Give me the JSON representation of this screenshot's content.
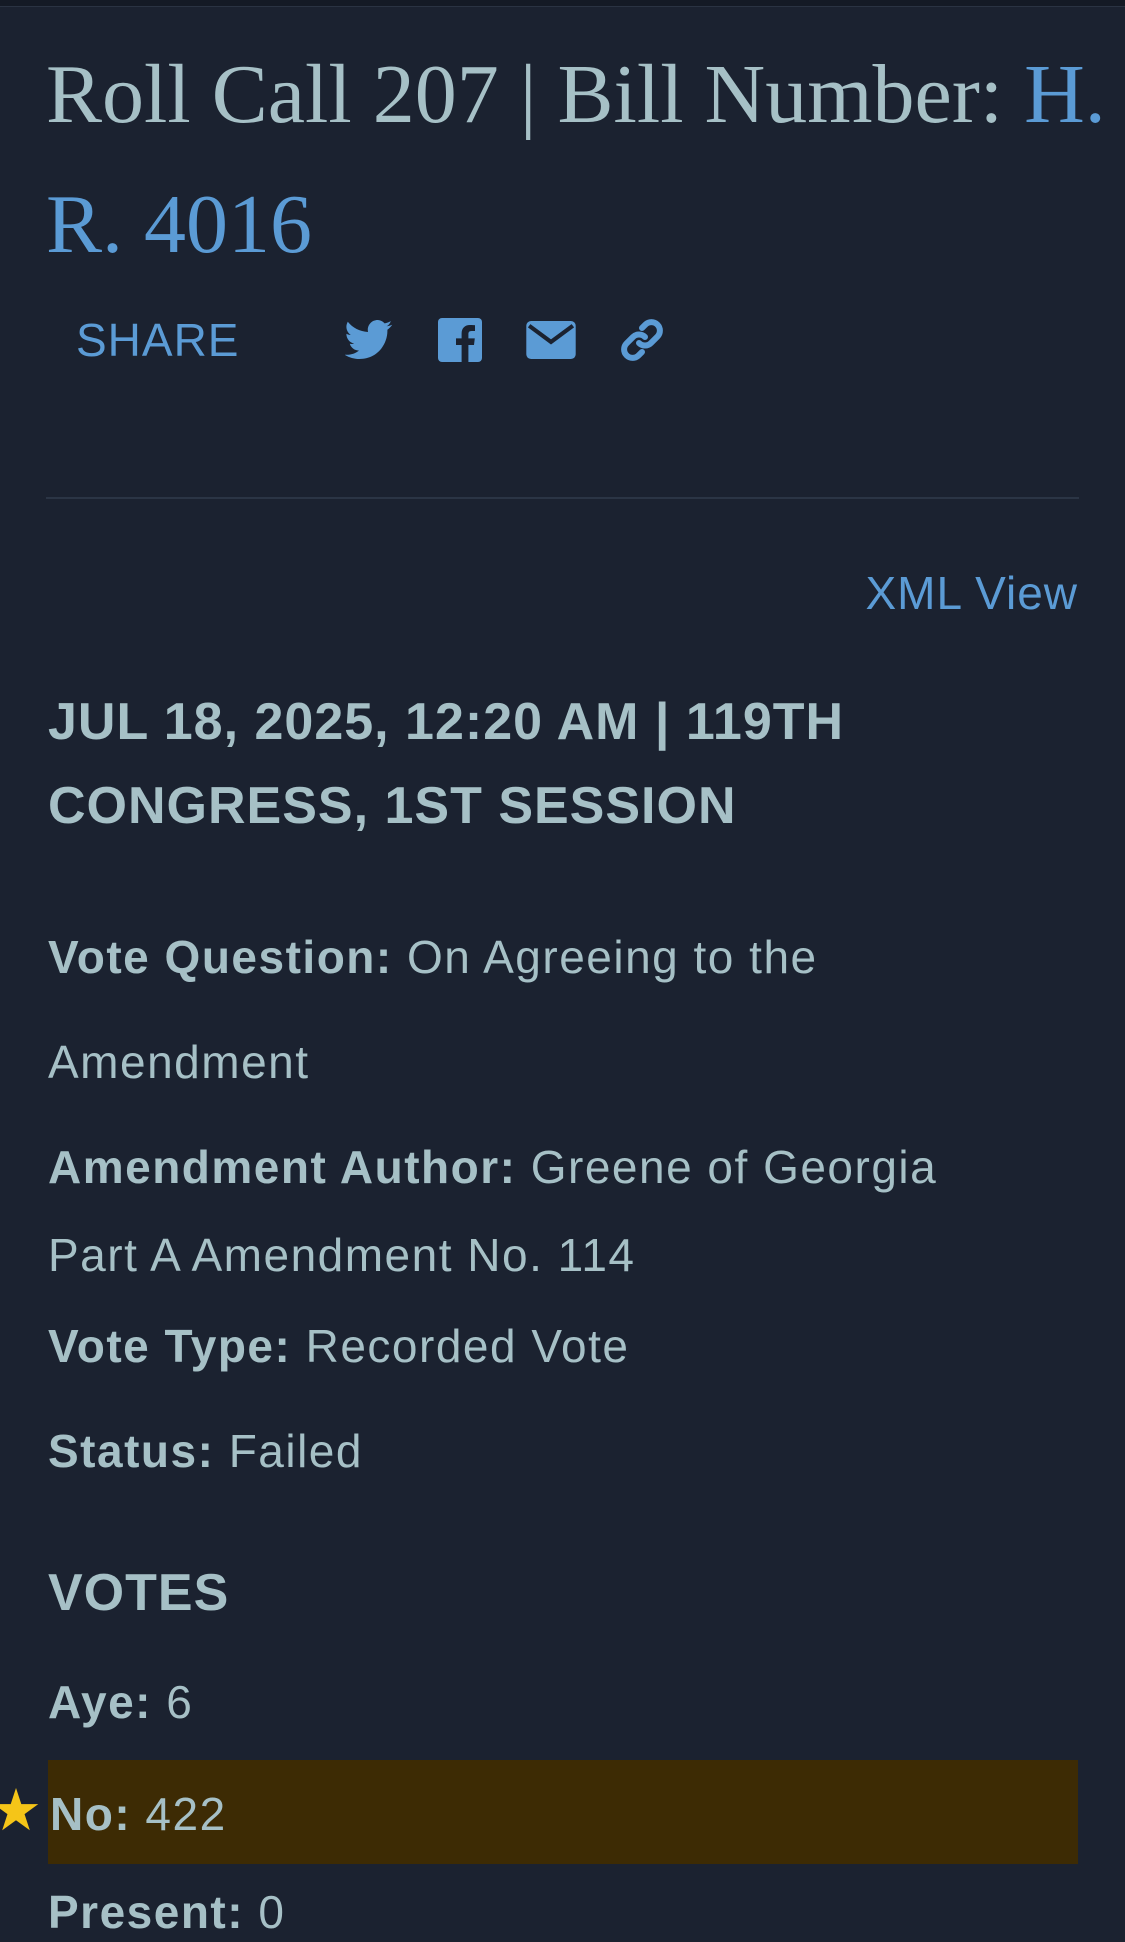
{
  "header": {
    "title_prefix": "Roll Call 207 | Bill Number: ",
    "bill_number": "H. R. 4016"
  },
  "share": {
    "label": "SHARE",
    "icons": [
      "twitter-icon",
      "facebook-icon",
      "email-icon",
      "link-icon"
    ]
  },
  "xml_view": "XML View",
  "meta": {
    "header": "JUL 18, 2025, 12:20 AM | 119TH CONGRESS, 1ST SESSION"
  },
  "fields": {
    "vote_question_label": "Vote Question:",
    "vote_question_value": "On Agreeing to the Amendment",
    "amendment_author_label": "Amendment Author:",
    "amendment_author_value": "Greene of Georgia",
    "amendment_part": "Part A Amendment No. 114",
    "vote_type_label": "Vote Type:",
    "vote_type_value": "Recorded Vote",
    "status_label": "Status:",
    "status_value": "Failed"
  },
  "votes": {
    "heading": "VOTES",
    "aye_label": "Aye:",
    "aye_value": "6",
    "no_label": "No:",
    "no_value": "422",
    "present_label": "Present:",
    "present_value": "0"
  },
  "colors": {
    "background": "#1b2230",
    "text": "#a6c0c6",
    "link": "#5b9bd5",
    "highlight": "#3d2b04",
    "star": "#f5c518"
  }
}
